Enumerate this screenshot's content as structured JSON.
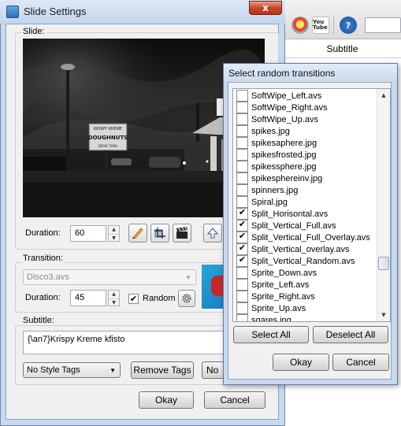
{
  "background_app": {
    "subtitle_column_header": "Subtitle",
    "toolbar_icons": [
      "record-icon",
      "youtube-icon",
      "help-icon"
    ],
    "youtube_text": "You Tube",
    "help_text": "?"
  },
  "dialog": {
    "title": "Slide Settings",
    "close_label": "x",
    "slide_group_label": "Slide:",
    "duration_label": "Duration:",
    "duration_value": "60",
    "transition_group_label": "Transition:",
    "transition_value": "Disco3.avs",
    "transition_duration_label": "Duration:",
    "transition_duration_value": "45",
    "random_label": "Random",
    "random_checked": true,
    "subtitle_group_label": "Subtitle:",
    "subtitle_text": "{\\an7}Krispy Kreme kfisto",
    "style_tags_value": "No Style Tags",
    "remove_tags_label": "Remove Tags",
    "partial_button_label": "No D",
    "ok_label": "Okay",
    "cancel_label": "Cancel",
    "preview_sign_top": "KRISPY KREME",
    "preview_sign_main": "DOUGHNUTS",
    "preview_sign_bottom": "DRIVE THRU"
  },
  "popup": {
    "title": "Select random transitions",
    "items": [
      {
        "label": "SoftWipe_Left.avs",
        "checked": false
      },
      {
        "label": "SoftWipe_Right.avs",
        "checked": false
      },
      {
        "label": "SoftWipe_Up.avs",
        "checked": false
      },
      {
        "label": "spikes.jpg",
        "checked": false
      },
      {
        "label": "spikesaphere.jpg",
        "checked": false
      },
      {
        "label": "spikesfrosted.jpg",
        "checked": false
      },
      {
        "label": "spikessphere.jpg",
        "checked": false
      },
      {
        "label": "spikesphereinv.jpg",
        "checked": false
      },
      {
        "label": "spinners.jpg",
        "checked": false
      },
      {
        "label": "Spiral.jpg",
        "checked": false
      },
      {
        "label": "Split_Horisontal.avs",
        "checked": true
      },
      {
        "label": "Split_Vertical_Full.avs",
        "checked": true
      },
      {
        "label": "Split_Vertical_Full_Overlay.avs",
        "checked": true
      },
      {
        "label": "Split_Vertical_overlay.avs",
        "checked": true
      },
      {
        "label": "Split_Vertical_Random.avs",
        "checked": true
      },
      {
        "label": "Sprite_Down.avs",
        "checked": false
      },
      {
        "label": "Sprite_Left.avs",
        "checked": false
      },
      {
        "label": "Sprite_Right.avs",
        "checked": false
      },
      {
        "label": "Sprite_Up.avs",
        "checked": false
      },
      {
        "label": "sqares.jpg",
        "checked": false
      }
    ],
    "select_all_label": "Select All",
    "deselect_all_label": "Deselect All",
    "ok_label": "Okay",
    "cancel_label": "Cancel"
  },
  "colors": {
    "window_frame": "#c8d9ee",
    "dialog_bg": "#f0f0f0",
    "close_button": "#c9452b"
  }
}
